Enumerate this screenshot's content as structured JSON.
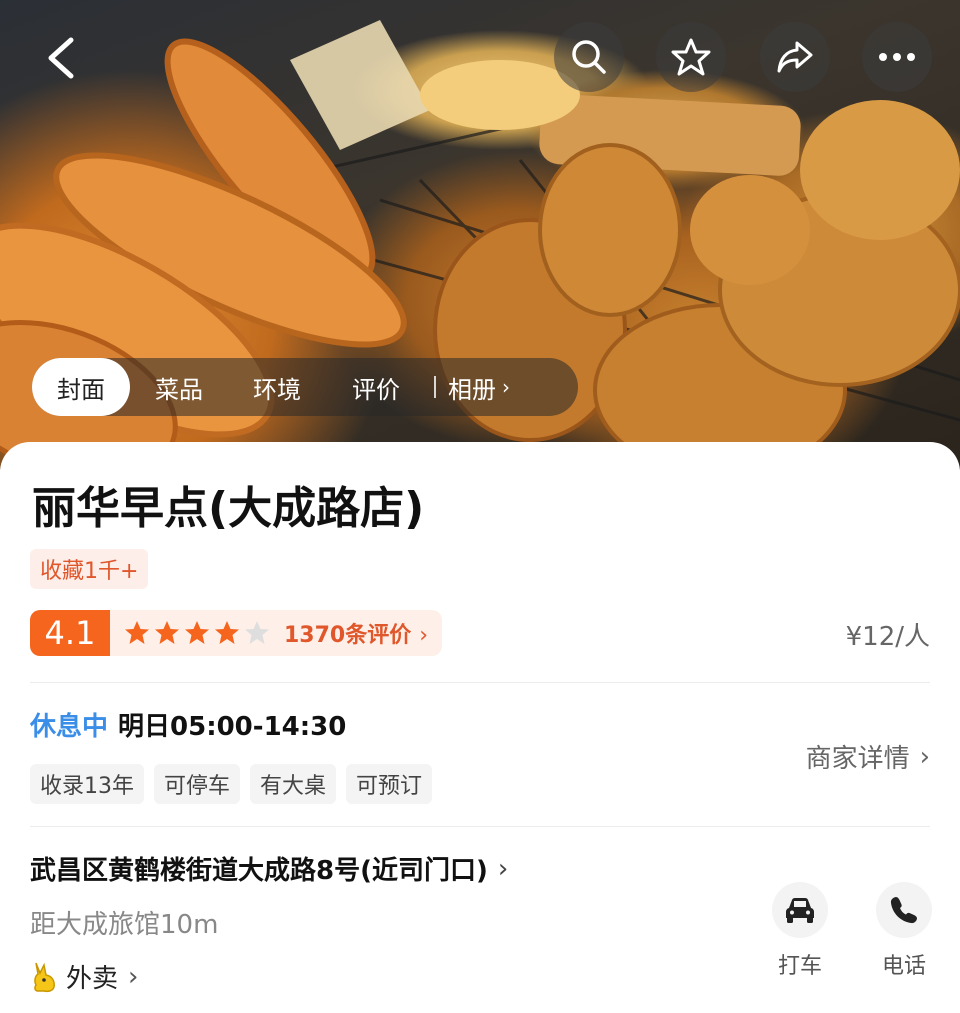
{
  "header": {
    "tabs": [
      {
        "label": "封面",
        "active": true
      },
      {
        "label": "菜品"
      },
      {
        "label": "环境"
      },
      {
        "label": "评价"
      },
      {
        "label": "相册"
      }
    ]
  },
  "shop": {
    "name": "丽华早点(大成路店)",
    "favorites": "收藏1千+",
    "score": "4.1",
    "stars_filled": 4,
    "stars_total": 5,
    "reviews": "1370条评价",
    "price": "¥12/人"
  },
  "hours": {
    "status": "休息中",
    "time": "明日05:00-14:30"
  },
  "tags": [
    "收录13年",
    "可停车",
    "有大桌",
    "可预订"
  ],
  "merchant_link": "商家详情",
  "location": {
    "address": "武昌区黄鹤楼街道大成路8号(近司门口)",
    "distance": "距大成旅馆10m",
    "delivery": "外卖"
  },
  "actions": {
    "taxi": "打车",
    "phone": "电话"
  },
  "colors": {
    "accent": "#f6651e",
    "accent_text": "#e0572b",
    "status_blue": "#3b8ee8"
  }
}
